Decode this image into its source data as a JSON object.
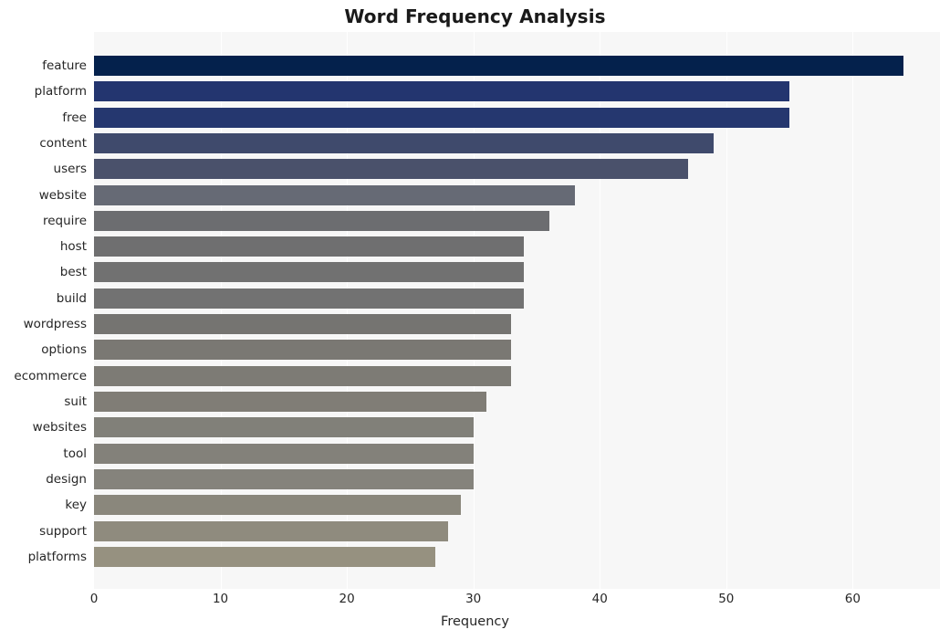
{
  "chart_data": {
    "type": "bar",
    "orientation": "horizontal",
    "title": "Word Frequency Analysis",
    "xlabel": "Frequency",
    "ylabel": "",
    "categories": [
      "feature",
      "platform",
      "free",
      "content",
      "users",
      "website",
      "require",
      "host",
      "best",
      "build",
      "wordpress",
      "options",
      "ecommerce",
      "suit",
      "websites",
      "tool",
      "design",
      "key",
      "support",
      "platforms"
    ],
    "values": [
      64,
      55,
      55,
      49,
      47,
      38,
      36,
      34,
      34,
      34,
      33,
      33,
      33,
      31,
      30,
      30,
      30,
      29,
      28,
      27
    ],
    "bar_colors": [
      "#04214c",
      "#23356f",
      "#25376f",
      "#3f4a6c",
      "#4a516b",
      "#666a75",
      "#6c6d70",
      "#6f6f70",
      "#717171",
      "#727272",
      "#757471",
      "#7a7873",
      "#7d7b75",
      "#807d76",
      "#818079",
      "#83817a",
      "#85837c",
      "#8a877c",
      "#8f8b7e",
      "#969180"
    ],
    "xlim": [
      0,
      66.9
    ],
    "xticks": [
      0,
      10,
      20,
      30,
      40,
      50,
      60
    ],
    "xtick_labels": [
      "0",
      "10",
      "20",
      "30",
      "40",
      "50",
      "60"
    ],
    "grid": true,
    "grid_axis": "x",
    "grid_color": "#ffffff",
    "legend": "none",
    "plot_background": "#f7f7f7",
    "figure_background": "#ffffff"
  }
}
